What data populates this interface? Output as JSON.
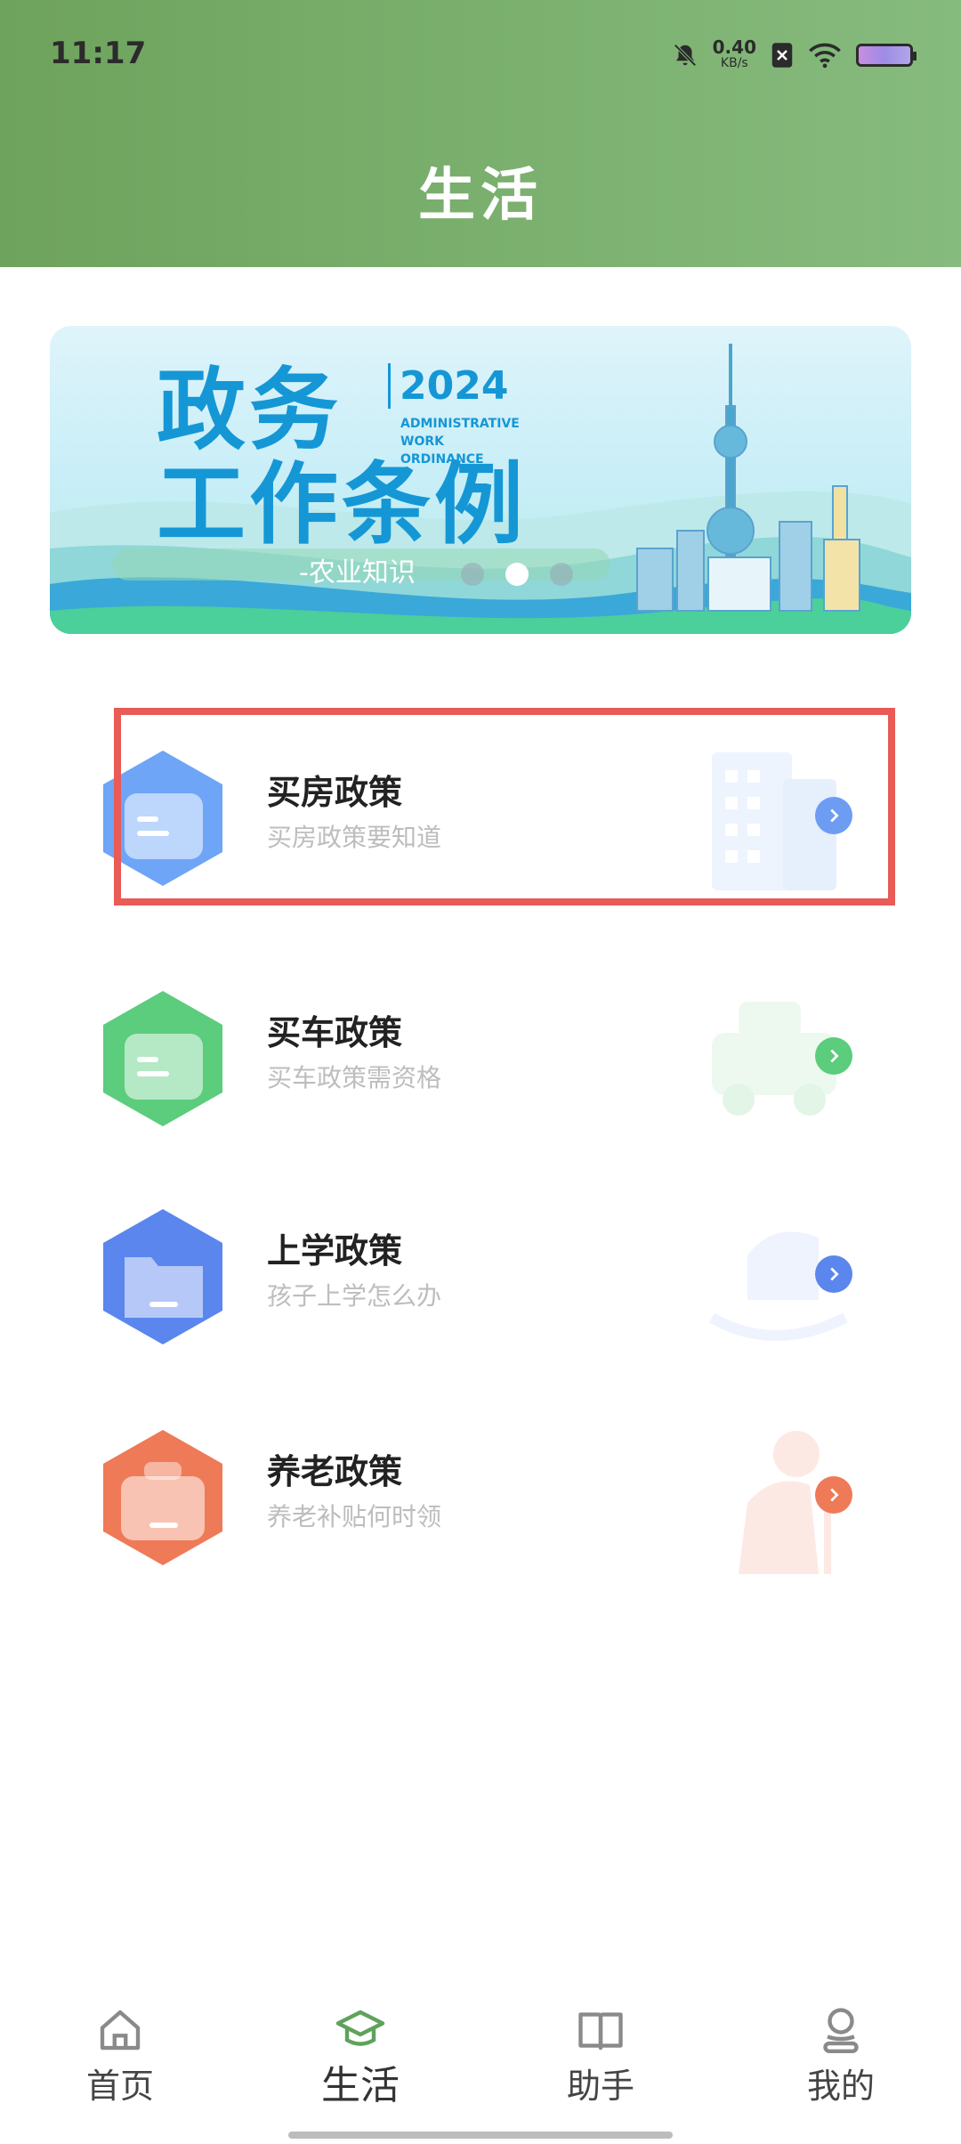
{
  "status_bar": {
    "time": "11:17",
    "net_speed_value": "0.40",
    "net_speed_unit": "KB/s",
    "icons": [
      "bell-muted-icon",
      "sim-x-icon",
      "wifi-icon",
      "battery-icon"
    ]
  },
  "header": {
    "title": "生活",
    "colors": {
      "from": "#6ea35d",
      "to": "#86bb7e"
    }
  },
  "banner": {
    "line1": "政务",
    "line2": "工作条例",
    "year": "2024",
    "english_line1": "ADMINISTRATIVE",
    "english_line2": "WORK ORDINANCE",
    "subtitle": "-农业知识",
    "active_dot": 2,
    "dots": 3
  },
  "policies": [
    {
      "title": "买房政策",
      "subtitle": "买房政策要知道",
      "icon": "house-document-icon",
      "color": "#6ea5f6",
      "arrow_color": "#6c9df2",
      "highlighted": true
    },
    {
      "title": "买车政策",
      "subtitle": "买车政策需资格",
      "icon": "car-document-icon",
      "color": "#5ccc7d",
      "arrow_color": "#5ccc7d",
      "highlighted": false
    },
    {
      "title": "上学政策",
      "subtitle": "孩子上学怎么办",
      "icon": "school-folder-icon",
      "color": "#5b86ee",
      "arrow_color": "#5b86ee",
      "highlighted": false
    },
    {
      "title": "养老政策",
      "subtitle": "养老补贴何时领",
      "icon": "pension-briefcase-icon",
      "color": "#ef7a57",
      "arrow_color": "#ef7a57",
      "highlighted": false
    }
  ],
  "bottom_nav": {
    "items": [
      {
        "label": "首页",
        "icon": "home-icon",
        "active": false
      },
      {
        "label": "生活",
        "icon": "graduation-cap-icon",
        "active": true
      },
      {
        "label": "助手",
        "icon": "book-icon",
        "active": false
      },
      {
        "label": "我的",
        "icon": "user-icon",
        "active": false
      }
    ],
    "active_color": "#5fa25c"
  }
}
